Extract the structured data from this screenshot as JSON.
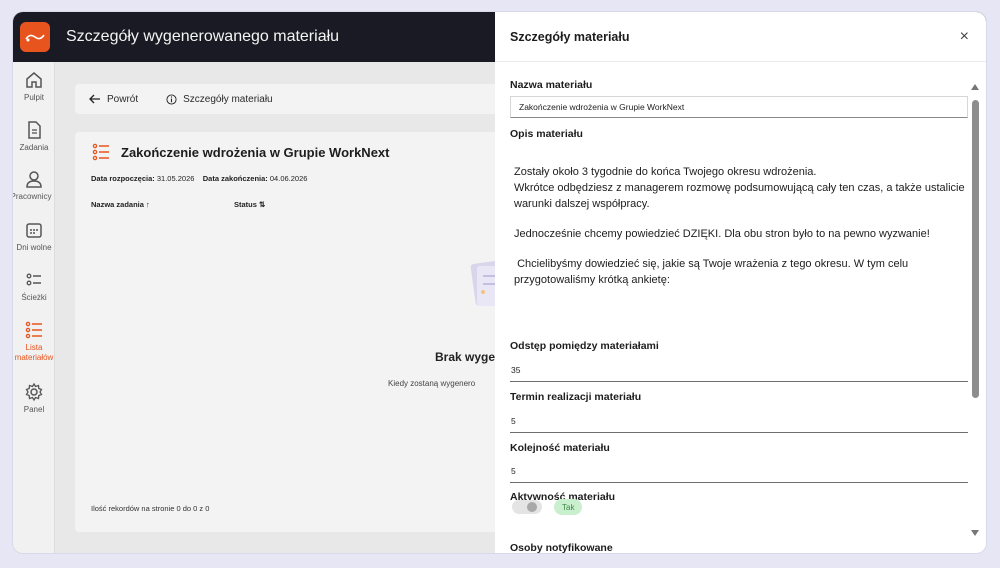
{
  "colors": {
    "accent": "#e8541d",
    "topbar": "#191a23",
    "badge_bg": "#c9efce"
  },
  "topbar": {
    "title": "Szczegóły wygenerowanego materiału",
    "logo_icon": "app-logo"
  },
  "sidenav": {
    "items": [
      {
        "label": "Pulpit",
        "icon": "home-icon"
      },
      {
        "label": "Zadania",
        "icon": "document-icon"
      },
      {
        "label": "Pracownicy",
        "icon": "user-icon"
      },
      {
        "label": "Dni wolne",
        "icon": "calendar-icon"
      },
      {
        "label": "Ścieżki",
        "icon": "path-list-icon"
      },
      {
        "label": "Lista materiałów",
        "icon": "materials-list-icon",
        "active": true
      },
      {
        "label": "Panel",
        "icon": "gear-icon"
      }
    ]
  },
  "main": {
    "back_label": "Powrót",
    "details_label": "Szczegóły materiału",
    "card": {
      "title": "Zakończenie wdrożenia w Grupie WorkNext",
      "start_label": "Data rozpoczęcia:",
      "start_value": "31.05.2026",
      "end_label": "Data zakończenia:",
      "end_value": "04.06.2026",
      "col_task": "Nazwa zadania ↑",
      "col_status": "Status ⇅",
      "empty_title": "Brak wyge",
      "empty_sub": "Kiedy zostaną wygenero",
      "records": "Ilość rekordów na stronie 0 do 0 z 0"
    }
  },
  "panel": {
    "title": "Szczegóły materiału",
    "close_label": "×",
    "name_label": "Nazwa materiału",
    "name_value": "Zakończenie wdrożenia w Grupie WorkNext",
    "desc_label": "Opis materiału",
    "desc_p1": "Zostały około 3 tygodnie do końca Twojego okresu wdrożenia.\nWkrótce odbędziesz z managerem rozmowę podsumowującą cały ten czas, a także ustalicie warunki dalszej współpracy.",
    "desc_p2": "Jednocześnie chcemy powiedzieć DZIĘKI. Dla obu stron było to na pewno wyzwanie!",
    "desc_p3": " Chcielibyśmy dowiedzieć się, jakie są Twoje wrażenia z tego okresu. W tym celu przygotowaliśmy krótką ankietę:",
    "gap_label": "Odstęp pomiędzy materiałami",
    "gap_value": "35",
    "term_label": "Termin realizacji materiału",
    "term_value": "5",
    "order_label": "Kolejność materiału",
    "order_value": "5",
    "active_label": "Aktywność materiału",
    "active_badge": "Tak",
    "notify_label": "Osoby notyfikowane"
  }
}
